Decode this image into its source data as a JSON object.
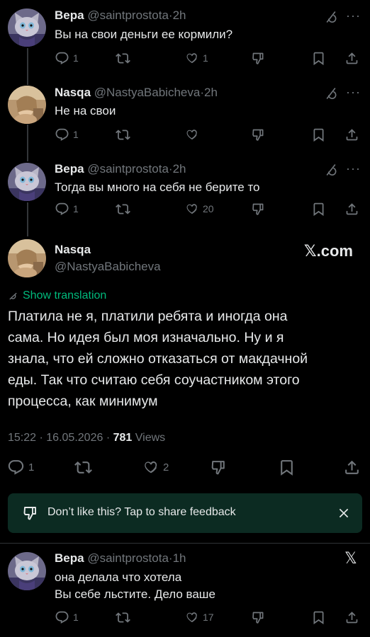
{
  "replies": [
    {
      "name": "Вера",
      "handle": "@saintprostota",
      "time": "2h",
      "text": "Вы на свои деньги ее кормили?",
      "reply_count": "1",
      "like_count": "1"
    },
    {
      "name": "Nasqa",
      "handle": "@NastyaBabicheva",
      "time": "2h",
      "text": "Не на свои",
      "reply_count": "1",
      "like_count": ""
    },
    {
      "name": "Вера",
      "handle": "@saintprostota",
      "time": "2h",
      "text": "Тогда вы много на себя не берите то",
      "reply_count": "1",
      "like_count": "20"
    }
  ],
  "main": {
    "name": "Nasqa",
    "handle": "@NastyaBabicheva",
    "watermark": "𝕏.com",
    "show_translation": "Show translation",
    "text_lines": [
      "Платила не я, платили ребята и иногда она",
      "сама. Но идея был моя изначально. Ну и я",
      "знала, что ей сложно отказаться от макдачной",
      "еды. Так что считаю себя соучастником этого",
      "процесса, как минимум"
    ],
    "time": "15:22",
    "date": "16.05.2026",
    "views_count": "781",
    "views_label": "Views",
    "reply_count": "1",
    "like_count": "2"
  },
  "feedback": {
    "text": "Don’t like this? Tap to share feedback"
  },
  "last_reply": {
    "name": "Вера",
    "handle": "@saintprostota",
    "time": "1h",
    "line1": "она делала что хотела",
    "line2": "Вы себе льстите. Дело ваше",
    "reply_count": "1",
    "like_count": "17",
    "close_glyph": "𝕏"
  },
  "sep": "·",
  "more_glyph": "···",
  "colors": {
    "background": "#000000",
    "text": "#e7e9ea",
    "muted": "#71767b",
    "translation": "#00ba7c",
    "banner_bg": "#0c2b22"
  }
}
